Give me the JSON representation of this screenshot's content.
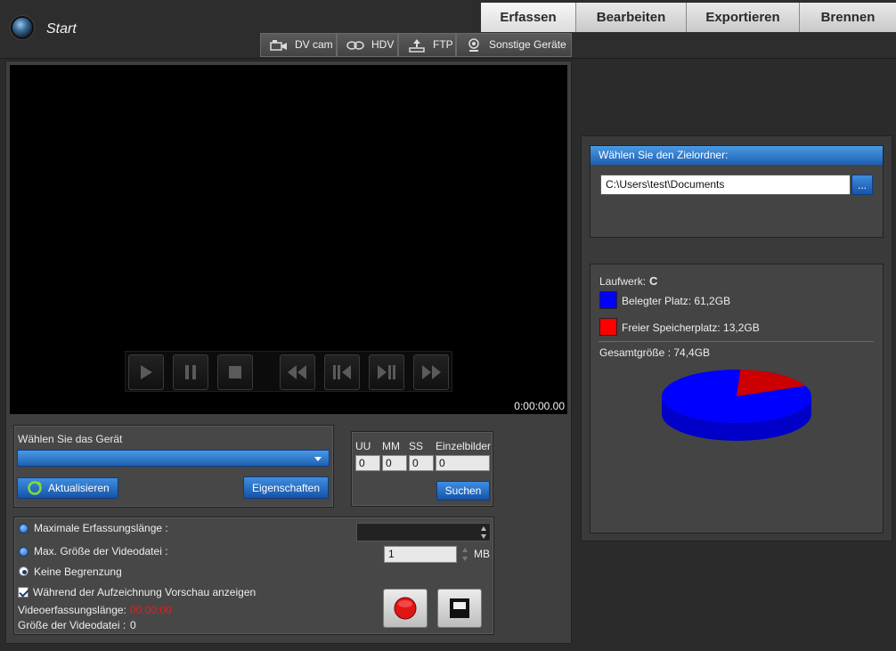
{
  "header": {
    "start_title": "Start",
    "main_tabs": [
      "Erfassen",
      "Bearbeiten",
      "Exportieren",
      "Brennen"
    ],
    "sub_tabs": [
      "DV cam",
      "HDV",
      "FTP",
      "Sonstige Geräte"
    ]
  },
  "player": {
    "timecode": "0:00:00.00"
  },
  "device": {
    "label": "Wählen Sie das Gerät",
    "selected": "",
    "refresh_label": "Aktualisieren",
    "properties_label": "Eigenschaften"
  },
  "timecode_search": {
    "col_uu": "UU",
    "col_mm": "MM",
    "col_ss": "SS",
    "col_frames": "Einzelbilder",
    "val_uu": "0",
    "val_mm": "0",
    "val_ss": "0",
    "val_frames": "0",
    "search_label": "Suchen"
  },
  "capture": {
    "opt_max_length": "Maximale Erfassungslänge :",
    "opt_max_size": "Max. Größe der Videodatei :",
    "opt_no_limit": "Keine Begrenzung",
    "length_value": "",
    "size_value": "1",
    "size_unit": "MB",
    "preview_label": "Während der Aufzeichnung Vorschau anzeigen",
    "length_label": "Videoerfassungslänge:",
    "length_readout": "00:00:00",
    "size_label": "Größe der Videodatei :",
    "size_readout": "0"
  },
  "target": {
    "header": "Wählen Sie den Zielordner:",
    "path": "C:\\Users\\test\\Documents",
    "browse_label": "..."
  },
  "drive": {
    "label": "Laufwerk:",
    "letter": "C",
    "used_label": "Belegter Platz: 61,2GB",
    "free_label": "Freier Speicherplatz: 13,2GB",
    "total_label": "Gesamtgröße : 74,4GB",
    "used_gb": 61.2,
    "free_gb": 13.2,
    "used_color": "#0000ff",
    "free_color": "#ff0000"
  }
}
